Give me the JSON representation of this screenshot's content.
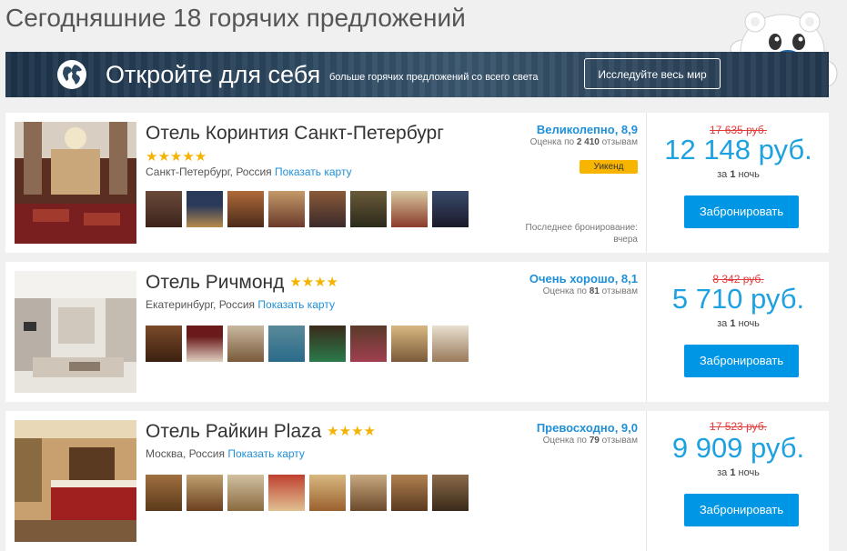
{
  "page": {
    "title": "Сегодняшние 18 горячих предложений"
  },
  "banner": {
    "title": "Откройте для себя",
    "subtitle": "больше горячих предложений со всего света",
    "button": "Исследуйте весь мир"
  },
  "hotels": [
    {
      "name": "Отель Коринтия Санкт-Петербург",
      "stars": "★★★★★",
      "location": "Санкт-Петербург, Россия",
      "map_link": "Показать карту",
      "rating_label": "Великолепно, 8,9",
      "reviews_prefix": "Оценка по",
      "reviews_count": "2 410",
      "reviews_suffix": "отзывам",
      "badge": "Уикенд",
      "last_booking_label": "Последнее бронирование:",
      "last_booking_value": "вчера",
      "old_price": "17 635 руб.",
      "price": "12 148 руб.",
      "nights_prefix": "за",
      "nights_count": "1",
      "nights_suffix": "ночь",
      "book_button": "Забронировать"
    },
    {
      "name": "Отель Ричмонд",
      "stars": "★★★★",
      "location": "Екатеринбург, Россия",
      "map_link": "Показать карту",
      "rating_label": "Очень хорошо, 8,1",
      "reviews_prefix": "Оценка по",
      "reviews_count": "81",
      "reviews_suffix": "отзывам",
      "old_price": "8 342 руб.",
      "price": "5 710 руб.",
      "nights_prefix": "за",
      "nights_count": "1",
      "nights_suffix": "ночь",
      "book_button": "Забронировать"
    },
    {
      "name": "Отель Райкин Plaza",
      "stars": "★★★★",
      "location": "Москва, Россия",
      "map_link": "Показать карту",
      "rating_label": "Превосходно, 9,0",
      "reviews_prefix": "Оценка по",
      "reviews_count": "79",
      "reviews_suffix": "отзывам",
      "old_price": "17 523 руб.",
      "price": "9 909 руб.",
      "nights_prefix": "за",
      "nights_count": "1",
      "nights_suffix": "ночь",
      "book_button": "Забронировать"
    }
  ]
}
